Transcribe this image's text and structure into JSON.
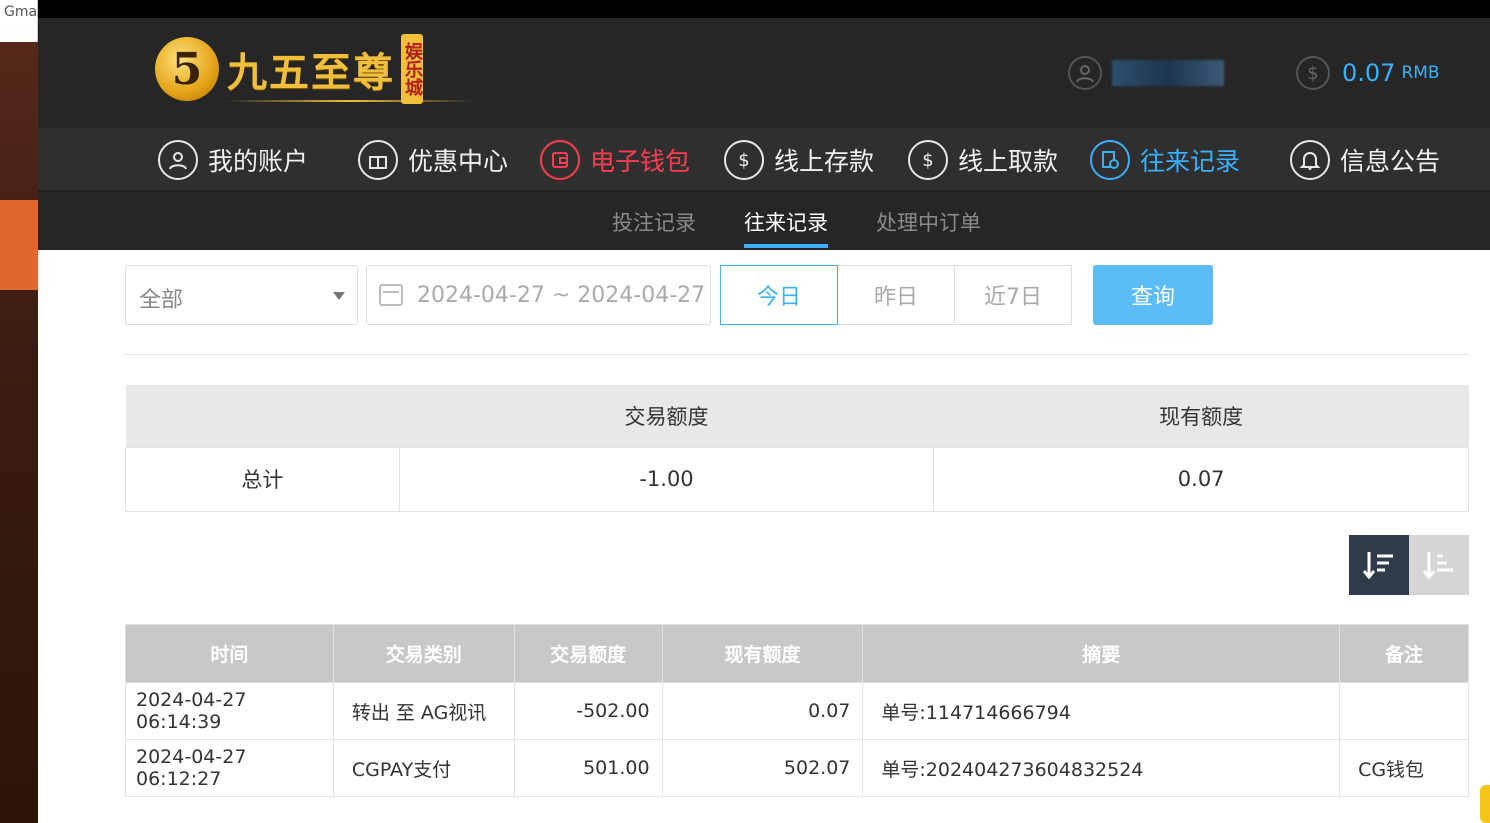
{
  "browser": {
    "tab_stub": "Gma"
  },
  "header": {
    "logo_badge": "5",
    "logo_text": "九五至尊",
    "logo_sub": "娱乐城",
    "balance": "0.07",
    "balance_unit": "RMB"
  },
  "nav": {
    "items": [
      {
        "label": "我的账户"
      },
      {
        "label": "优惠中心"
      },
      {
        "label": "电子钱包"
      },
      {
        "label": "线上存款"
      },
      {
        "label": "线上取款"
      },
      {
        "label": "往来记录"
      },
      {
        "label": "信息公告"
      }
    ]
  },
  "subnav": {
    "items": [
      "投注记录",
      "往来记录",
      "处理中订单"
    ]
  },
  "filters": {
    "type_value": "全部",
    "date_range": "2024-04-27 ~ 2024-04-27",
    "quick": [
      "今日",
      "昨日",
      "近7日"
    ],
    "query_label": "查询"
  },
  "summary": {
    "headers": [
      "",
      "交易额度",
      "现有额度"
    ],
    "row": [
      "总计",
      "-1.00",
      "0.07"
    ]
  },
  "records": {
    "headers": [
      "时间",
      "交易类别",
      "交易额度",
      "现有额度",
      "摘要",
      "备注"
    ],
    "rows": [
      [
        "2024-04-27 06:14:39",
        "转出 至 AG视讯",
        "-502.00",
        "0.07",
        "单号:114714666794",
        ""
      ],
      [
        "2024-04-27 06:12:27",
        "CGPAY支付",
        "501.00",
        "502.07",
        "单号:202404273604832524",
        "CG钱包"
      ]
    ]
  }
}
